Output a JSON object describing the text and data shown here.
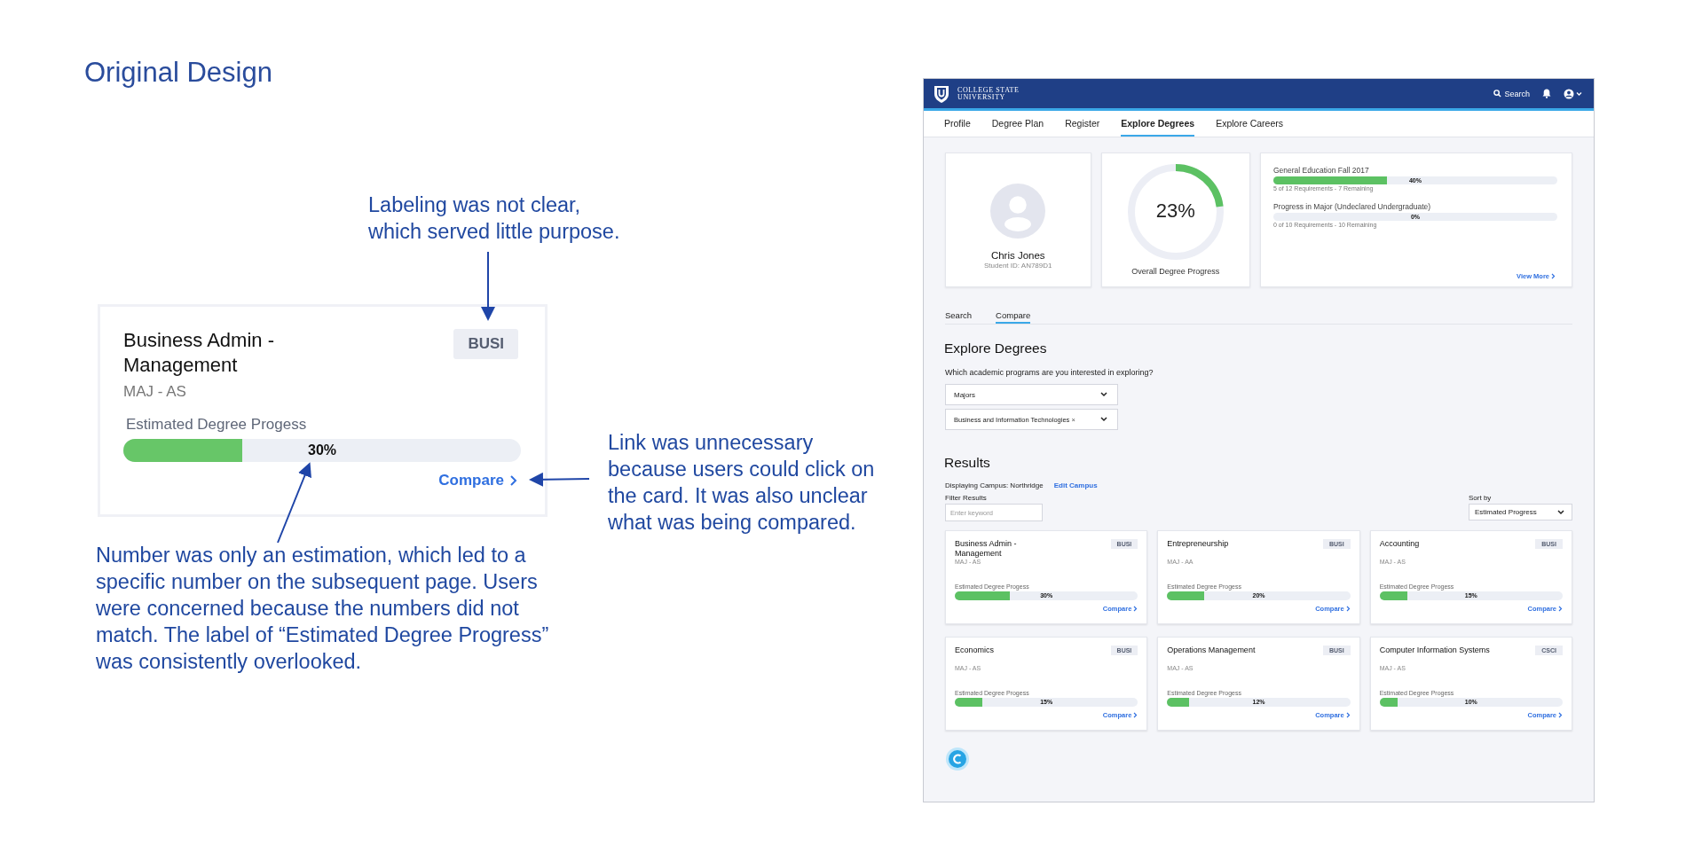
{
  "title": "Original Design",
  "annotations": [
    {
      "kind": "top",
      "text": "Labeling was not clear,\nwhich served little purpose."
    },
    {
      "kind": "right",
      "text": "Link was unnecessary\nbecause users could click on\nthe card. It was also unclear\nwhat was being compared."
    },
    {
      "kind": "bottom",
      "text": "Number was only an estimation, which led to a\nspecific number on the subsequent page.  Users\nwere concerned because the numbers did not\nmatch. The label of “Estimated Degree Progress”\nwas consistently overlooked."
    }
  ],
  "example_card": {
    "title": "Business Admin -\nManagement",
    "code": "BUSI",
    "degree": "MAJ - AS",
    "progress_label": "Estimated Degree Progess",
    "level": 0.3,
    "percent": "30%",
    "link": "Compare"
  },
  "app": {
    "header": {
      "logo_line1": "COLLEGE STATE",
      "logo_line2": "UNIVERSITY",
      "search": "Search"
    },
    "nav": [
      {
        "label": "Profile",
        "selected": false
      },
      {
        "label": "Degree Plan",
        "selected": false
      },
      {
        "label": "Register",
        "selected": false
      },
      {
        "label": "Explore Degrees",
        "selected": true
      },
      {
        "label": "Explore Careers",
        "selected": false
      }
    ],
    "student": {
      "name": "Chris Jones",
      "id": "Student ID: AN789D1"
    },
    "overall": {
      "percent": "23%",
      "level": 0.23,
      "label": "Overall Degree Progress"
    },
    "progress": [
      {
        "label": "General Education Fall 2017",
        "level": 0.4,
        "percent": "40%",
        "detail": "5 of 12 Requirements - 7 Remaining"
      },
      {
        "label": "Progress in Major (Undeclared Undergraduate)",
        "percent": "0%",
        "detail": "0 of 10 Requirements - 10 Remaining"
      }
    ],
    "view_more": "View More",
    "subtabs": [
      {
        "label": "Search",
        "selected": false
      },
      {
        "label": "Compare",
        "selected": true
      }
    ],
    "heading": "Explore Degrees",
    "question": "Which academic programs are you interested in exploring?",
    "dropdowns": [
      {
        "kind": "select",
        "value": "Majors"
      },
      {
        "kind": "tag",
        "value": "Business and Information Technologies",
        "remove": "×"
      }
    ],
    "results_heading": "Results",
    "campus": "Displaying Campus: Northridge",
    "edit_campus": "Edit Campus",
    "filter_label": "Filter Results",
    "filter_placeholder": "Enter keyword",
    "sort_label": "Sort by",
    "sort_value": "Estimated Progress",
    "programs": [
      {
        "title": "Business Admin -\nManagement",
        "code": "BUSI",
        "degree": "MAJ - AS",
        "progress_label": "Estimated Degree Progess",
        "level": 0.3,
        "percent": "30%",
        "link": "Compare"
      },
      {
        "title": "Entrepreneurship",
        "code": "BUSI",
        "degree": "MAJ - AA",
        "progress_label": "Estimated Degree Progess",
        "level": 0.2,
        "percent": "20%",
        "link": "Compare"
      },
      {
        "title": "Accounting",
        "code": "BUSI",
        "degree": "MAJ - AS",
        "progress_label": "Estimated Degree Progess",
        "level": 0.15,
        "percent": "15%",
        "link": "Compare"
      },
      {
        "title": "Economics",
        "code": "BUSI",
        "degree": "MAJ - AS",
        "progress_label": "Estimated Degree Progess",
        "level": 0.15,
        "percent": "15%",
        "link": "Compare"
      },
      {
        "title": "Operations Management",
        "code": "BUSI",
        "degree": "MAJ - AS",
        "progress_label": "Estimated Degree Progess",
        "level": 0.12,
        "percent": "12%",
        "link": "Compare"
      },
      {
        "title": "Computer Information Systems",
        "code": "CSCI",
        "degree": "MAJ - AS",
        "progress_label": "Estimated Degree Progess",
        "level": 0.1,
        "percent": "10%",
        "link": "Compare"
      }
    ]
  }
}
